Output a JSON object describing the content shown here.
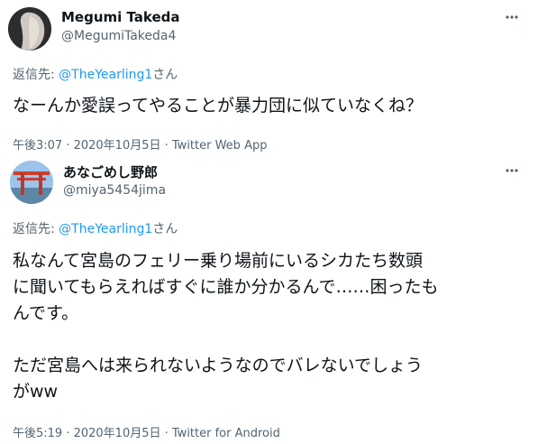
{
  "tweets": [
    {
      "display_name": "Megumi Takeda",
      "handle": "@MegumiTakeda4",
      "reply_prefix": "返信先: ",
      "reply_mention": "@TheYearling1",
      "reply_suffix": "さん",
      "text": "なーんか愛誤ってやることが暴力団に似ていなくね？",
      "time": "午後3:07 · 2020年10月5日 · ",
      "source": "Twitter Web App"
    },
    {
      "display_name": "あなごめし野郎",
      "handle": "@miya5454jima",
      "reply_prefix": "返信先: ",
      "reply_mention": "@TheYearling1",
      "reply_suffix": "さん",
      "text_lines": [
        "私なんて宮島のフェリー乗り場前にいるシカたち数頭",
        "に聞いてもらえればすぐに誰か分かるんで……困ったも",
        "んです。",
        "ただ宮島へは来られないようなのでバレないでしょう",
        "がww"
      ],
      "time": "午後5:19 · 2020年10月5日 · ",
      "source": "Twitter for Android"
    }
  ],
  "icons": {
    "more": "more-dots-icon"
  },
  "colors": {
    "text": "#0f1419",
    "secondary": "#536471",
    "link": "#1d9bf0"
  }
}
